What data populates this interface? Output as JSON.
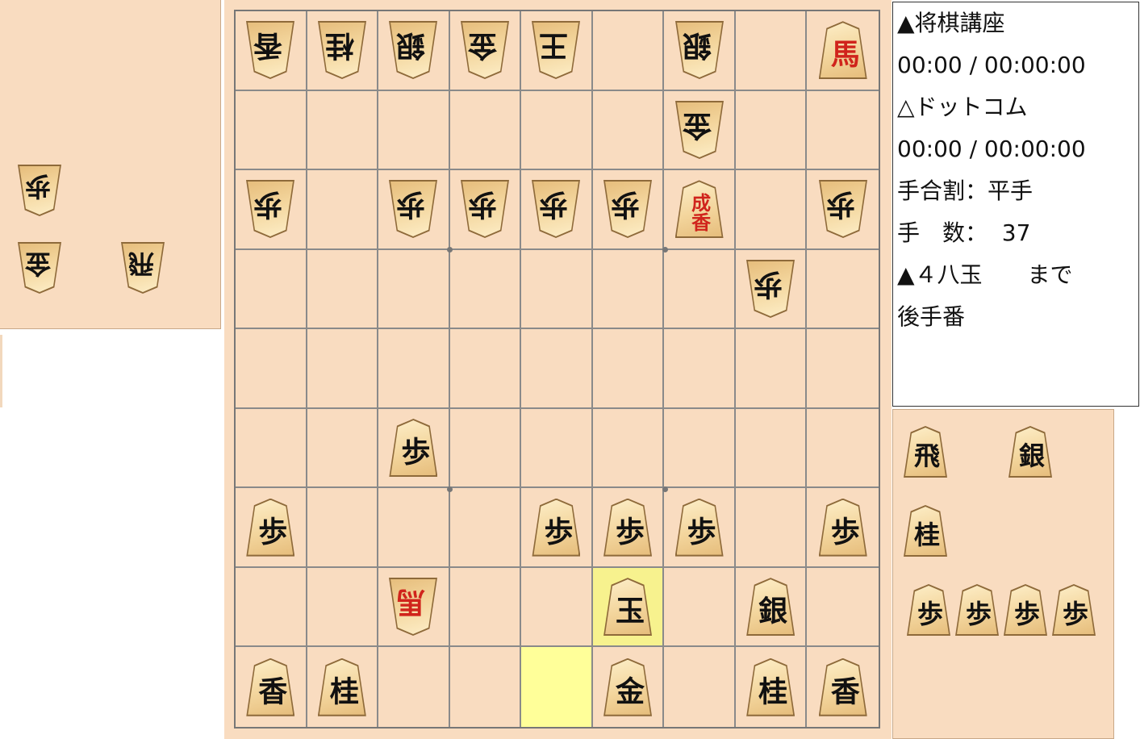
{
  "info": {
    "lines": [
      "▲将棋講座",
      "00:00 / 00:00:00",
      "△ドットコム",
      "00:00 / 00:00:00",
      "手合割：平手",
      "手　数：  37",
      "▲４八玉　　まで",
      "後手番"
    ]
  },
  "board": {
    "rows": [
      [
        {
          "t": "香",
          "o": "g"
        },
        {
          "t": "桂",
          "o": "g"
        },
        {
          "t": "銀",
          "o": "g"
        },
        {
          "t": "金",
          "o": "g"
        },
        {
          "t": "王",
          "o": "g"
        },
        null,
        {
          "t": "銀",
          "o": "g"
        },
        null,
        {
          "t": "馬",
          "o": "s",
          "p": true
        }
      ],
      [
        null,
        null,
        null,
        null,
        null,
        null,
        {
          "t": "金",
          "o": "g"
        },
        null,
        null
      ],
      [
        {
          "t": "歩",
          "o": "g"
        },
        null,
        {
          "t": "歩",
          "o": "g"
        },
        {
          "t": "歩",
          "o": "g"
        },
        {
          "t": "歩",
          "o": "g"
        },
        {
          "t": "歩",
          "o": "g"
        },
        {
          "t": "成香",
          "o": "s",
          "p": true
        },
        null,
        {
          "t": "歩",
          "o": "g"
        }
      ],
      [
        null,
        null,
        null,
        null,
        null,
        null,
        null,
        {
          "t": "歩",
          "o": "g"
        },
        null
      ],
      [
        null,
        null,
        null,
        null,
        null,
        null,
        null,
        null,
        null
      ],
      [
        null,
        null,
        {
          "t": "歩",
          "o": "s"
        },
        null,
        null,
        null,
        null,
        null,
        null
      ],
      [
        {
          "t": "歩",
          "o": "s"
        },
        null,
        null,
        null,
        {
          "t": "歩",
          "o": "s"
        },
        {
          "t": "歩",
          "o": "s"
        },
        {
          "t": "歩",
          "o": "s"
        },
        null,
        {
          "t": "歩",
          "o": "s"
        }
      ],
      [
        null,
        null,
        {
          "t": "馬",
          "o": "g",
          "p": true
        },
        null,
        null,
        {
          "t": "玉",
          "o": "s"
        },
        null,
        {
          "t": "銀",
          "o": "s"
        },
        null
      ],
      [
        {
          "t": "香",
          "o": "s"
        },
        {
          "t": "桂",
          "o": "s"
        },
        null,
        null,
        null,
        {
          "t": "金",
          "o": "s"
        },
        null,
        {
          "t": "桂",
          "o": "s"
        },
        {
          "t": "香",
          "o": "s"
        }
      ]
    ],
    "highlight_to": "7-5",
    "highlight_from": "8-4"
  },
  "gote_hand": [
    {
      "t": "歩"
    },
    {
      "t": "金"
    },
    {
      "t": "飛"
    }
  ],
  "sente_hand": [
    {
      "t": "飛"
    },
    {
      "t": "銀"
    },
    {
      "t": "桂"
    },
    {
      "t": "歩"
    },
    {
      "t": "歩"
    },
    {
      "t": "歩"
    },
    {
      "t": "歩"
    }
  ]
}
